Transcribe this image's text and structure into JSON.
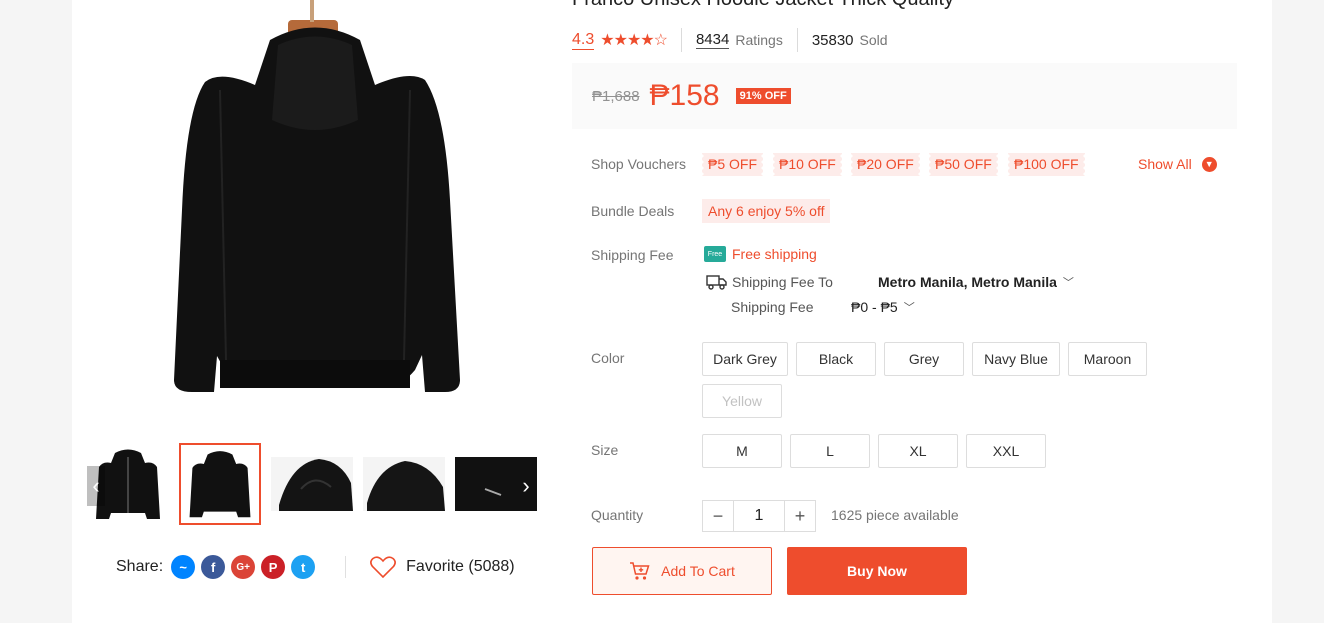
{
  "product": {
    "title": "Franco Unisex Hoodie Jacket Thick Quality",
    "rating": "4.3",
    "stars": "★★★★☆",
    "ratings_count": "8434",
    "ratings_label": "Ratings",
    "sold_count": "35830",
    "sold_label": "Sold",
    "old_price": "₱1,688",
    "price": "₱158",
    "discount": "91% OFF"
  },
  "vouchers": {
    "label": "Shop Vouchers",
    "items": [
      "₱5 OFF",
      "₱10 OFF",
      "₱20 OFF",
      "₱50 OFF",
      "₱100 OFF"
    ],
    "show_all": "Show All"
  },
  "bundle": {
    "label": "Bundle Deals",
    "deal": "Any 6 enjoy 5% off"
  },
  "shipping": {
    "label": "Shipping Fee",
    "free_tag": "Free",
    "free_text": "Free shipping",
    "to_label": "Shipping Fee To",
    "to_value": "Metro Manila, Metro Manila",
    "fee_label": "Shipping Fee",
    "fee_value": "₱0 - ₱5"
  },
  "color": {
    "label": "Color",
    "options": [
      "Dark Grey",
      "Black",
      "Grey",
      "Navy Blue",
      "Maroon",
      "Yellow"
    ]
  },
  "size": {
    "label": "Size",
    "options": [
      "M",
      "L",
      "XL",
      "XXL"
    ]
  },
  "quantity": {
    "label": "Quantity",
    "value": "1",
    "available": "1625 piece available"
  },
  "actions": {
    "add_to_cart": "Add To Cart",
    "buy_now": "Buy Now"
  },
  "share": {
    "label": "Share:",
    "favorite": "Favorite (5088)"
  },
  "colors": {
    "accent": "#ee4d2d",
    "free_shipping": "#26aa99"
  }
}
